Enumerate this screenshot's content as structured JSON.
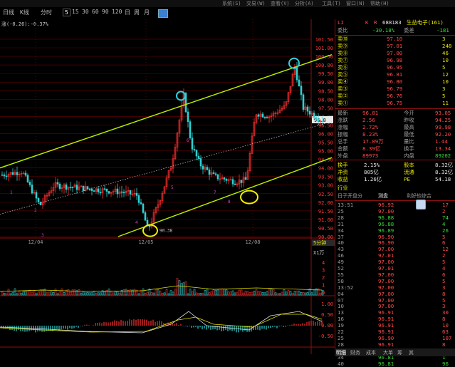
{
  "menubar": {
    "items": [
      "系统(S)",
      "交易(W)",
      "查看(V)",
      "分析(A)",
      "工具(T)",
      "窗口(N)",
      "帮助(H)"
    ]
  },
  "toolbar": {
    "items": [
      "日线",
      "K线",
      "分时",
      "5",
      "15",
      "30",
      "60",
      "90",
      "120",
      "日",
      "周",
      "月"
    ],
    "selected_index": 3
  },
  "chart": {
    "indicator_text": "涨(-0.26):-0.37%",
    "date_labels": [
      "12/04",
      "12/05",
      "12/08"
    ],
    "price_ticks": [
      "101.50",
      "101.00",
      "100.50",
      "100.00",
      "99.50",
      "99.00",
      "98.50",
      "98.00",
      "97.50",
      "97.00",
      "96.50",
      "96.00",
      "95.50",
      "95.00",
      "94.50",
      "94.00",
      "93.50",
      "93.00",
      "92.50",
      "92.00",
      "91.50",
      "91.00",
      "90.50",
      "90.00"
    ],
    "current_price_tag": "96.8",
    "low_price_label": "90.38",
    "volume_label": "X1万",
    "volume_ticks": [
      "4",
      "3",
      "2",
      "1",
      "0"
    ],
    "macd_ticks": [
      "1.00",
      "0.50",
      "0.00",
      "-0.50"
    ],
    "macd_bottom_label": "-0.50",
    "bottom_axis_label": "5分钟",
    "colors": {
      "channel": "#b8f000",
      "upper_circle": "#30d0e0",
      "lower_circle": "#f0f000",
      "up": "#ff3030",
      "down": "#30d0d0"
    }
  },
  "quote_panel": {
    "code": "688183",
    "name": "生益电子(161)",
    "header_letters": [
      "LI",
      "K",
      "R"
    ],
    "weibi_label": "委比",
    "weibi_value": "-30.18%",
    "weicha_label": "委差",
    "weicha_value": "-181",
    "sell_orders": [
      {
        "label": "卖⑩",
        "price": "97.10",
        "vol": "3"
      },
      {
        "label": "卖⑨",
        "price": "97.01",
        "vol": "248"
      },
      {
        "label": "卖⑧",
        "price": "97.00",
        "vol": "46"
      },
      {
        "label": "卖⑦",
        "price": "96.98",
        "vol": "10"
      },
      {
        "label": "卖⑥",
        "price": "96.95",
        "vol": "5"
      },
      {
        "label": "卖⑤",
        "price": "96.81",
        "vol": "12"
      },
      {
        "label": "卖④",
        "price": "96.80",
        "vol": "10"
      },
      {
        "label": "卖③",
        "price": "96.79",
        "vol": "3"
      },
      {
        "label": "卖②",
        "price": "96.76",
        "vol": "5"
      },
      {
        "label": "卖①",
        "price": "96.75",
        "vol": "11"
      }
    ],
    "stats": [
      {
        "l1": "最新",
        "v1": "96.81",
        "l2": "今开",
        "v2": "93.05"
      },
      {
        "l1": "涨跌",
        "v1": "2.56",
        "l2": "昨收",
        "v2": "94.25"
      },
      {
        "l1": "涨幅",
        "v1": "2.72%",
        "l2": "最高",
        "v2": "99.98"
      },
      {
        "l1": "振幅",
        "v1": "8.23%",
        "l2": "最低",
        "v2": "92.20"
      },
      {
        "l1": "总手",
        "v1": "17.89万",
        "l2": "量比",
        "v2": "1.44"
      },
      {
        "l1": "金额",
        "v1": "8.39亿",
        "l2": "换手",
        "v2": "13.34"
      },
      {
        "l1": "外盘",
        "v1": "89973",
        "l2": "内盘",
        "v2": "89202"
      }
    ],
    "extra": [
      {
        "l1": "换手",
        "v1": "2.15%",
        "l2": "股本",
        "v2": "8.32亿"
      },
      {
        "l1": "净资",
        "v1": "805亿",
        "l2": "流通",
        "v2": "8.32亿"
      },
      {
        "l1": "收益",
        "v1": "1.26亿",
        "l2": "PE",
        "v2": "54.18"
      }
    ],
    "industry_label": "行业",
    "tabs": [
      "日子开盘分",
      "测盘",
      "利好较综合"
    ],
    "ticks": [
      {
        "t": "13:51",
        "p": "96.92",
        "v": "17"
      },
      {
        "t": "25",
        "p": "97.00",
        "v": "2"
      },
      {
        "t": "28",
        "p": "96.88",
        "v": "74"
      },
      {
        "t": "31",
        "p": "96.88",
        "v": "4"
      },
      {
        "t": "34",
        "p": "96.89",
        "v": "26"
      },
      {
        "t": "37",
        "p": "96.90",
        "v": "5"
      },
      {
        "t": "40",
        "p": "96.90",
        "v": "6"
      },
      {
        "t": "43",
        "p": "97.00",
        "v": "12"
      },
      {
        "t": "46",
        "p": "97.01",
        "v": "2"
      },
      {
        "t": "49",
        "p": "97.00",
        "v": "5"
      },
      {
        "t": "52",
        "p": "97.01",
        "v": "4"
      },
      {
        "t": "55",
        "p": "97.00",
        "v": "6"
      },
      {
        "t": "58",
        "p": "97.00",
        "v": "5"
      },
      {
        "t": "13:52",
        "p": "97.00",
        "v": "3"
      },
      {
        "t": "04",
        "p": "97.00",
        "v": "8"
      },
      {
        "t": "07",
        "p": "97.00",
        "v": "5"
      },
      {
        "t": "10",
        "p": "97.00",
        "v": "3"
      },
      {
        "t": "13",
        "p": "96.91",
        "v": "30"
      },
      {
        "t": "16",
        "p": "96.91",
        "v": "8"
      },
      {
        "t": "19",
        "p": "96.91",
        "v": "10"
      },
      {
        "t": "22",
        "p": "96.91",
        "v": "63"
      },
      {
        "t": "25",
        "p": "96.90",
        "v": "107"
      },
      {
        "t": "28",
        "p": "96.91",
        "v": "8"
      },
      {
        "t": "31",
        "p": "96.91",
        "v": "3"
      },
      {
        "t": "34",
        "p": "96.81",
        "v": "1"
      },
      {
        "t": "40",
        "p": "96.81",
        "v": "96"
      }
    ],
    "bottom_tabs": [
      "明细",
      "财务",
      "成本",
      "大单",
      "筹",
      "其"
    ]
  }
}
